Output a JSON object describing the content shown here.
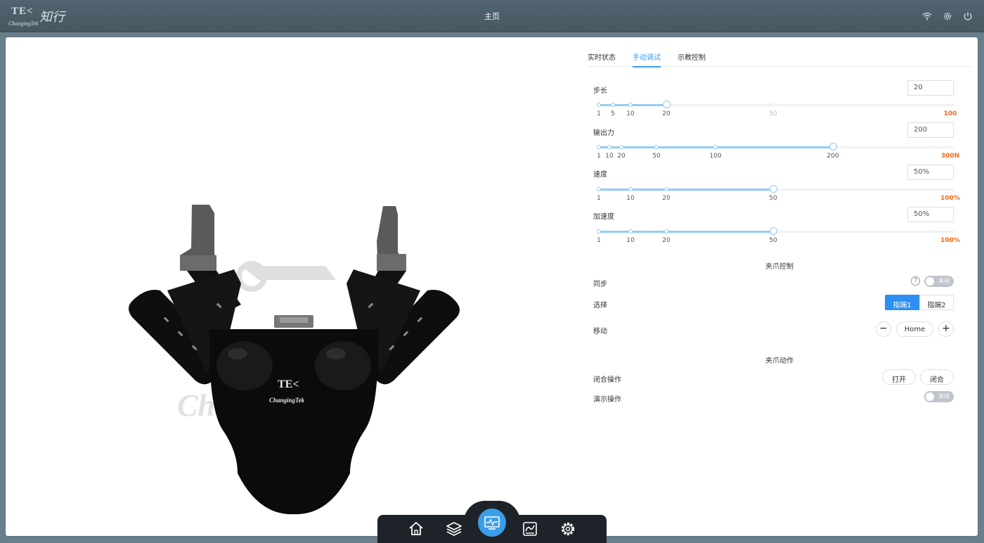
{
  "header": {
    "logo_text": "TE<",
    "logo_cn": "知行",
    "logo_sub": "ChangingTek",
    "title": "主页",
    "icons": [
      "wifi-icon",
      "gear-icon",
      "power-icon"
    ]
  },
  "viewer": {
    "watermark": "ChangingTek",
    "device_logo": "TE<",
    "device_brand": "ChangingTek"
  },
  "tabs": [
    {
      "label": "实时状态",
      "active": false
    },
    {
      "label": "手动调试",
      "active": true
    },
    {
      "label": "示教控制",
      "active": false
    }
  ],
  "sliders": [
    {
      "label": "步长",
      "value": "20",
      "ticks": [
        "1",
        "5",
        "10",
        "20",
        "50"
      ],
      "max": "100",
      "current": 20
    },
    {
      "label": "输出力",
      "value": "200",
      "ticks": [
        "1",
        "10",
        "20",
        "50",
        "100",
        "200"
      ],
      "max": "300N",
      "current": 200
    },
    {
      "label": "速度",
      "value": "50%",
      "ticks": [
        "1",
        "10",
        "20",
        "50"
      ],
      "max": "100%",
      "current": 50
    },
    {
      "label": "加速度",
      "value": "50%",
      "ticks": [
        "1",
        "10",
        "20",
        "50"
      ],
      "max": "100%",
      "current": 50
    }
  ],
  "gripper_control": {
    "section_title": "夹爪控制",
    "sync_label": "同步",
    "sync_help": "?",
    "sync_state": "关闭",
    "select_label": "选择",
    "select_options": [
      "指端1",
      "指端2"
    ],
    "move_label": "移动",
    "move_minus": "−",
    "move_home": "Home",
    "move_plus": "+"
  },
  "gripper_action": {
    "section_title": "夹爪动作",
    "close_op_label": "闭合操作",
    "open_btn": "打开",
    "close_btn": "闭合",
    "demo_label": "演示操作",
    "demo_state": "关闭"
  },
  "dock": {
    "items": [
      "home-icon",
      "layers-icon",
      "monitor-icon",
      "chart-icon",
      "settings-icon"
    ],
    "active": "monitor-icon"
  },
  "colors": {
    "header_bg": "#4b5e69",
    "accent": "#3a9ee8",
    "slider": "#8fcdf2",
    "max_label": "#f06a1a",
    "dock_bg": "#1e232a"
  }
}
